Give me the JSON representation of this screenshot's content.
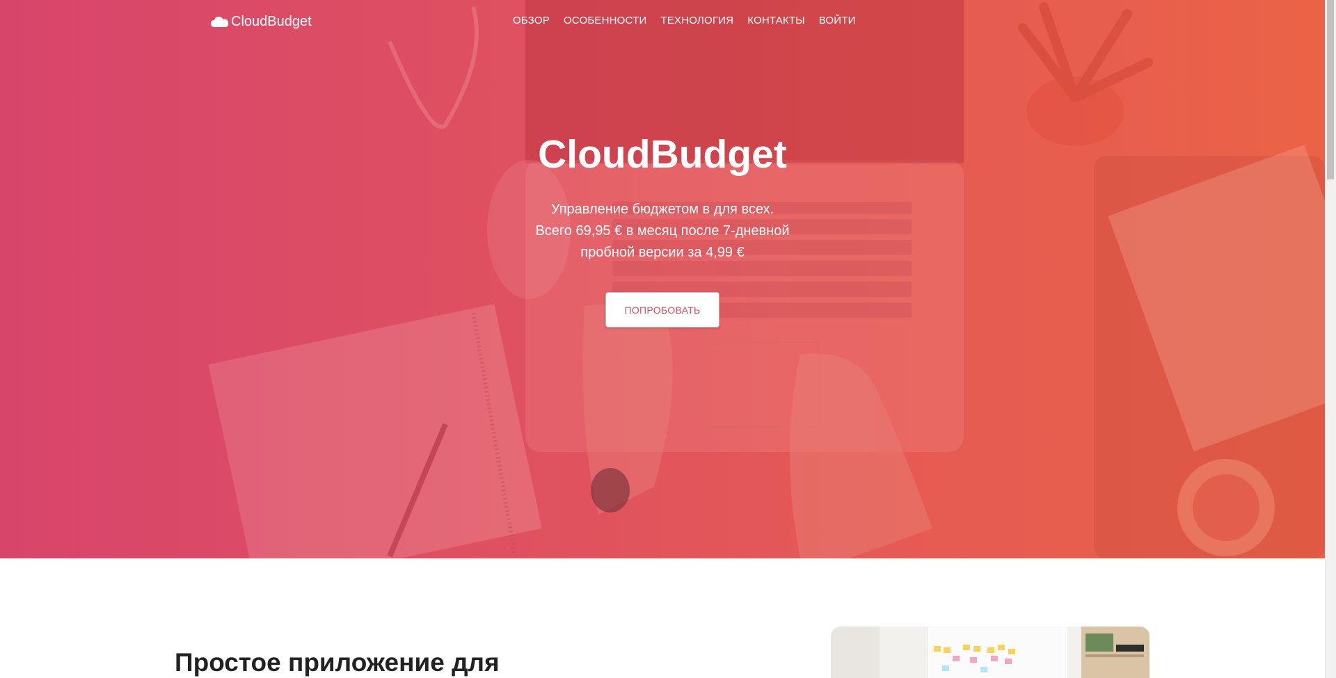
{
  "nav": {
    "brand": "CloudBudget",
    "brand_icon": "cloud-icon",
    "items": [
      "ОБЗОР",
      "ОСОБЕННОСТИ",
      "ТЕХНОЛОГИЯ",
      "КОНТАКТЫ",
      "ВОЙТИ"
    ]
  },
  "hero": {
    "title": "CloudBudget",
    "subtitle_lines": [
      "Управление бюджетом в для всех.",
      "Всего 69,95 € в месяц после 7-дневной",
      "пробной версии за 4,99 €"
    ],
    "cta_label": "ПОПРОБОВАТЬ",
    "cta_color": "#d94c5f",
    "gradient_colors": [
      "#d9496d",
      "#e0555f",
      "#ea6247"
    ]
  },
  "section2": {
    "heading": "Простое приложение для"
  }
}
